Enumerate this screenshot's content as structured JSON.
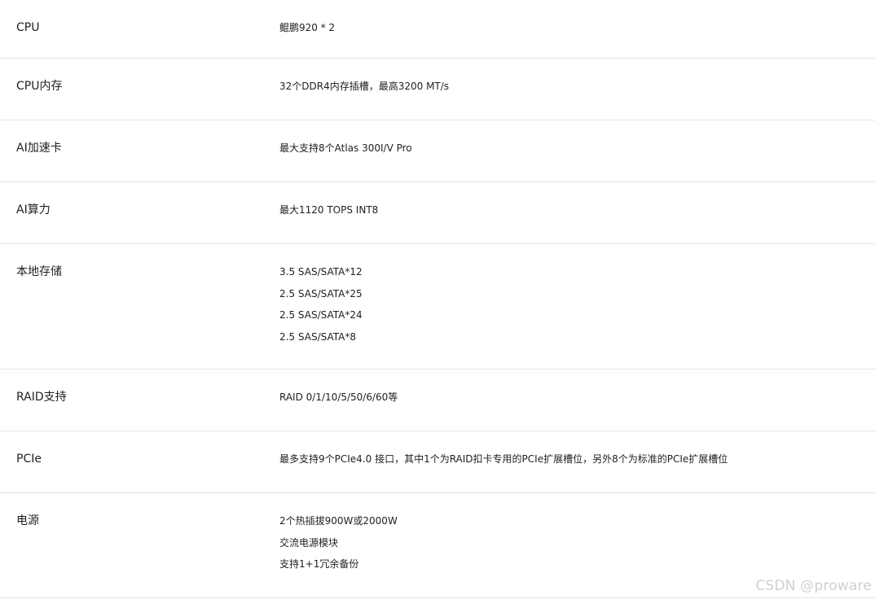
{
  "specs": [
    {
      "label": "CPU",
      "values": [
        "鲲鹏920 * 2"
      ]
    },
    {
      "label": "CPU内存",
      "values": [
        "32个DDR4内存插槽，最高3200 MT/s"
      ]
    },
    {
      "label": "AI加速卡",
      "values": [
        "最大支持8个Atlas 300I/V Pro"
      ]
    },
    {
      "label": "AI算力",
      "values": [
        "最大1120 TOPS INT8"
      ]
    },
    {
      "label": "本地存储",
      "values": [
        "3.5 SAS/SATA*12",
        "2.5 SAS/SATA*25",
        "2.5 SAS/SATA*24",
        "2.5 SAS/SATA*8"
      ]
    },
    {
      "label": "RAID支持",
      "values": [
        "RAID 0/1/10/5/50/6/60等"
      ]
    },
    {
      "label": "PCIe",
      "values": [
        "最多支持9个PCIe4.0 接口，其中1个为RAID扣卡专用的PCIe扩展槽位，另外8个为标准的PCIe扩展槽位"
      ]
    },
    {
      "label": "电源",
      "values": [
        "2个热插拔900W或2000W",
        "交流电源模块",
        "支持1+1冗余备份"
      ]
    }
  ],
  "watermark": "CSDN @proware"
}
